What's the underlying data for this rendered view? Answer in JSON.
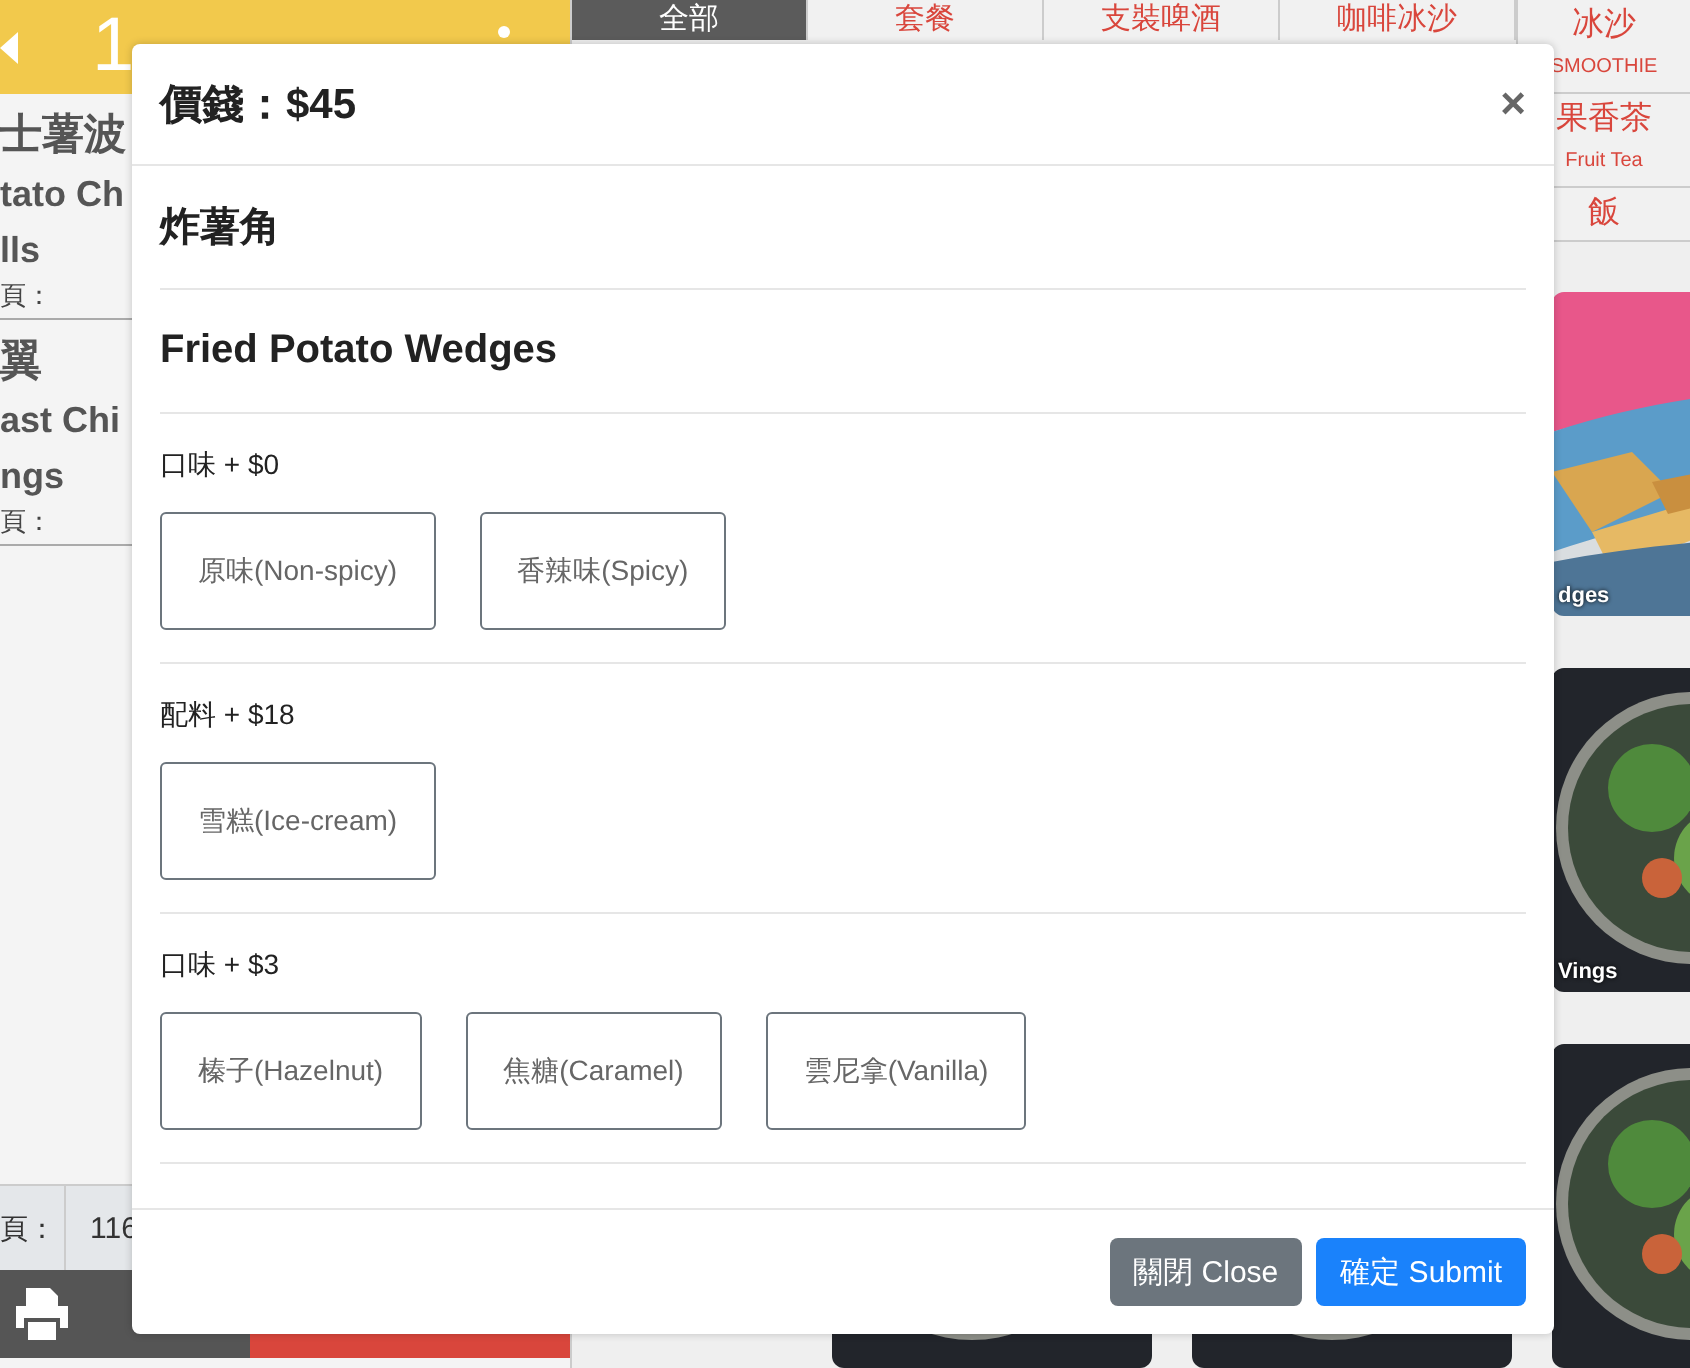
{
  "header": {
    "title": "1"
  },
  "order_items": [
    {
      "lines": [
        "士薯波",
        "tato Ch",
        "lls"
      ],
      "label": "頁："
    },
    {
      "lines": [
        "翼",
        "ast Chi",
        "ngs"
      ],
      "label": "頁："
    }
  ],
  "summary": {
    "label": "頁：",
    "value": "116"
  },
  "tabs": [
    {
      "label": "全部",
      "selected": true
    },
    {
      "label": "套餐",
      "selected": false
    },
    {
      "label": "支裝啤酒",
      "selected": false
    },
    {
      "label": "咖啡冰沙",
      "selected": false
    }
  ],
  "categories": [
    {
      "label": "冰沙",
      "sub": "SMOOTHIE"
    },
    {
      "label": "果香茶",
      "sub": "Fruit Tea"
    },
    {
      "label": "飯"
    }
  ],
  "cards": [
    {
      "kind": "picture",
      "caption": "dges"
    },
    {
      "kind": "picture",
      "caption": "Vings"
    },
    {
      "kind": "picture"
    },
    {
      "kind": "picture"
    },
    {
      "kind": "picture"
    }
  ],
  "modal": {
    "title": "價錢：$45",
    "close": "×",
    "name_zh": "炸薯角",
    "name_en": "Fried Potato Wedges",
    "groups": [
      {
        "label": "口味 + $0",
        "options": [
          {
            "label": "原味(Non-spicy)",
            "selected": false
          },
          {
            "label": "香辣味(Spicy)",
            "selected": false
          }
        ]
      },
      {
        "label": "配料 + $18",
        "options": [
          {
            "label": "雪糕(Ice-cream)",
            "selected": false
          }
        ]
      },
      {
        "label": "口味 + $3",
        "options": [
          {
            "label": "榛子(Hazelnut)",
            "selected": false
          },
          {
            "label": "焦糖(Caramel)",
            "selected": false
          },
          {
            "label": "雲尼拿(Vanilla)",
            "selected": false
          }
        ]
      }
    ],
    "buttons": [
      {
        "label": "關閉 Close",
        "kind": "secondary"
      },
      {
        "label": "確定 Submit",
        "kind": "primary"
      }
    ]
  }
}
